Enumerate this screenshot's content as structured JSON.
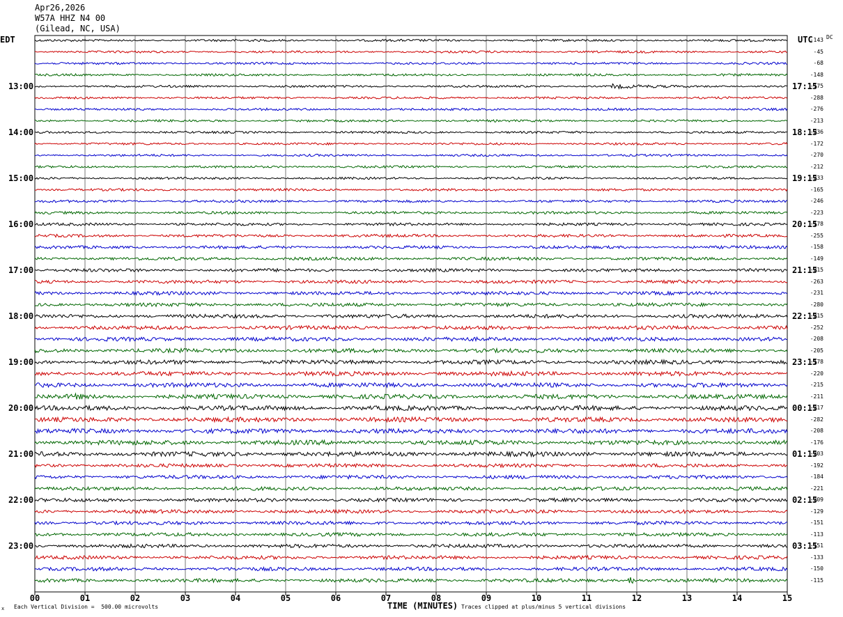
{
  "header": {
    "date": "Apr26,2026",
    "station": "W57A HHZ N4 00",
    "location": "(Gilead, NC, USA)"
  },
  "left_tz": "EDT",
  "right_tz": "UTC",
  "dc_header": "DC",
  "footer": {
    "scale_note": "Each Vertical Division =  500.00 microvolts",
    "clip_note": "Traces clipped at plus/minus 5 vertical divisions",
    "corner_mark": "x"
  },
  "colors": {
    "trace_cycle": [
      "#000000",
      "#cc0000",
      "#0000cc",
      "#006600"
    ],
    "grid": "#000000"
  },
  "chart_data": {
    "type": "line",
    "title": "W57A HHZ N4 00 (Gilead, NC, USA)",
    "xlabel": "TIME (MINUTES)",
    "x_ticks": [
      "00",
      "01",
      "02",
      "03",
      "04",
      "05",
      "06",
      "07",
      "08",
      "09",
      "10",
      "11",
      "12",
      "13",
      "14",
      "15"
    ],
    "xlim": [
      0,
      15
    ],
    "grid": true,
    "left_hour_labels": [
      "13:00",
      "14:00",
      "15:00",
      "16:00",
      "17:00",
      "18:00",
      "19:00",
      "20:00",
      "21:00",
      "22:00",
      "23:00"
    ],
    "right_hour_labels": [
      "17:15",
      "18:15",
      "19:15",
      "20:15",
      "21:15",
      "22:15",
      "23:15",
      "00:15",
      "01:15",
      "02:15",
      "03:15"
    ],
    "traces_per_hour": 4,
    "trace_count": 48,
    "dc_offsets": [
      -143,
      -45,
      -68,
      -148,
      -175,
      -288,
      -276,
      -213,
      -236,
      -172,
      -270,
      -212,
      -233,
      -165,
      -246,
      -223,
      -178,
      -255,
      -158,
      -149,
      -215,
      -263,
      -231,
      -280,
      -215,
      -252,
      -208,
      -205,
      -178,
      -220,
      -215,
      -211,
      -217,
      -282,
      -208,
      -176,
      -203,
      -192,
      -184,
      -221,
      -209,
      -129,
      -151,
      -113,
      -151,
      -133,
      -150,
      -115
    ],
    "events": [
      {
        "trace": 4,
        "minute": 11.5,
        "duration": 1.4,
        "amplitude": 2.5
      },
      {
        "trace": 47,
        "minute": 11.8,
        "duration": 0.3,
        "amplitude": 9
      },
      {
        "trace": 31,
        "minute": 0.8,
        "duration": 0.2,
        "amplitude": 4
      }
    ]
  }
}
